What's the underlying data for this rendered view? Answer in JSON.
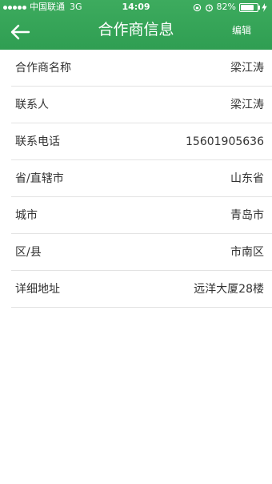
{
  "status_bar": {
    "carrier": "中国联通",
    "network": "3G",
    "time": "14:09",
    "battery": "82%",
    "battery_level": 0.82
  },
  "nav": {
    "title": "合作商信息",
    "edit_label": "编辑"
  },
  "rows": [
    {
      "label": "合作商名称",
      "value": "梁江涛"
    },
    {
      "label": "联系人",
      "value": "梁江涛"
    },
    {
      "label": "联系电话",
      "value": "15601905636"
    },
    {
      "label": "省/直辖市",
      "value": "山东省"
    },
    {
      "label": "城市",
      "value": "青岛市"
    },
    {
      "label": "区/县",
      "value": "市南区"
    },
    {
      "label": "详细地址",
      "value": "远洋大厦28楼"
    }
  ],
  "colors": {
    "header_green": "#2f9e52",
    "divider": "#e3e3e3"
  }
}
